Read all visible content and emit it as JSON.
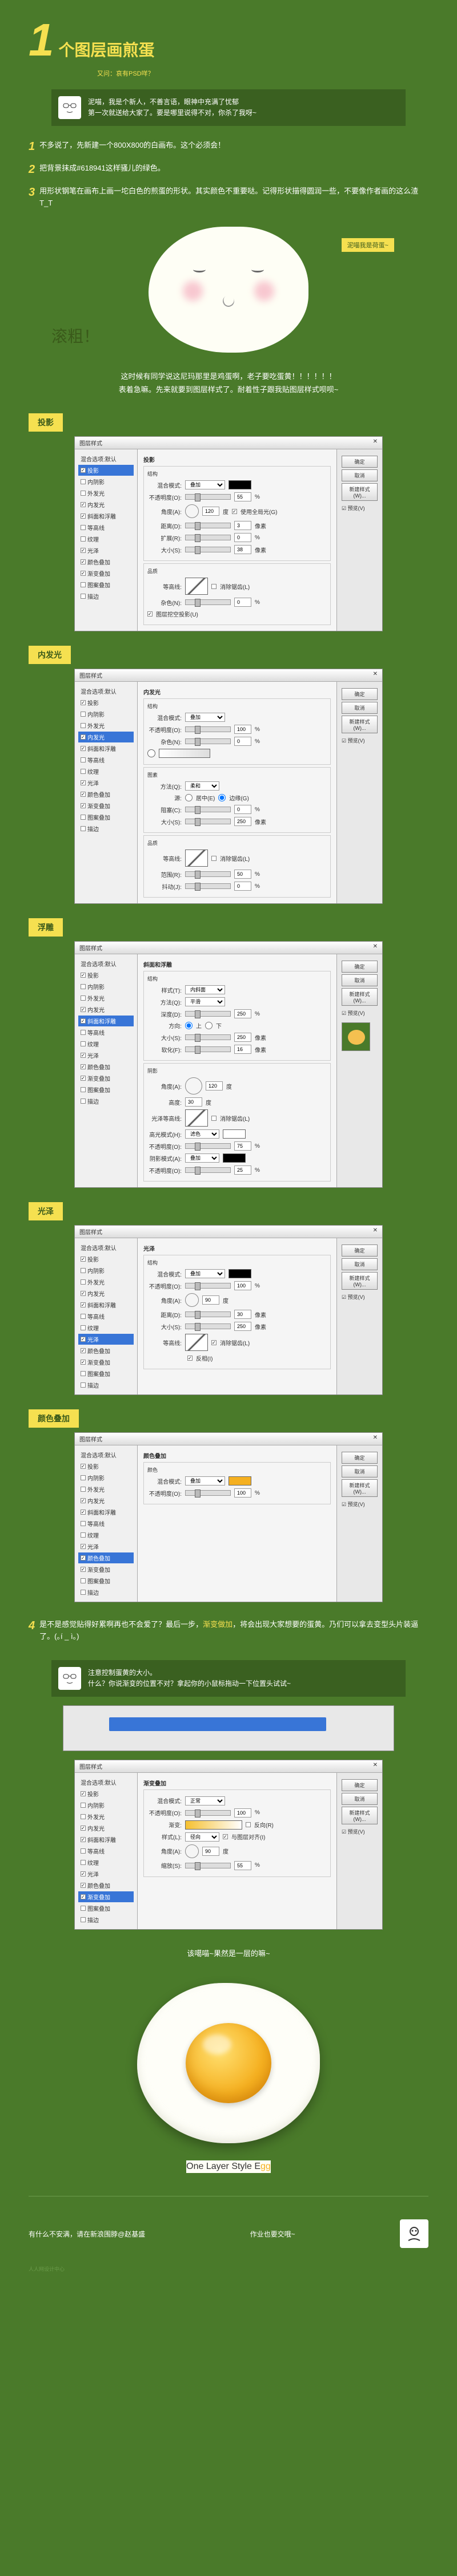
{
  "header": {
    "number": "1",
    "title": "个图层画煎蛋",
    "subtitle": "又问：哀有PSD咩？"
  },
  "intro": {
    "line1": "泥喵，我是个新人，不善言语，眼神中充满了忧郁",
    "line2": "第一次就送给大家了。要是哪里说得不对，你杀了我呀~"
  },
  "steps": [
    {
      "num": "1",
      "text": "不多说了，先新建一个800X800的白画布。这个必须会！"
    },
    {
      "num": "2",
      "text": "把背景抹成#618941这样骚儿的绿色。"
    },
    {
      "num": "3",
      "text": "用形状钢笔在画布上画一坨白色的煎蛋的形状。其实颜色不重要哒。记得形状描得圆润一些，不要像作者画的这么渣　　　　　T_T"
    }
  ],
  "blob": {
    "tag": "泥喵我是荷蛋~",
    "scroll": "滚粗！"
  },
  "mid_text": {
    "line1": "这时候有同学说这尼玛那里是鸡蛋啊，老子要吃蛋黄！！！！！！",
    "line2": "表着急嘛。先来就要到图层样式了。耐着性子跟我贴图层样式呗呗~"
  },
  "panels": {
    "p1": {
      "label": "投影"
    },
    "p2": {
      "label": "内发光"
    },
    "p3": {
      "label": "浮雕"
    },
    "p4": {
      "label": "光泽"
    },
    "p5": {
      "label": "颜色叠加"
    }
  },
  "ps": {
    "title": "图层样式",
    "left_items": [
      "混合选项:默认",
      "投影",
      "内阴影",
      "外发光",
      "内发光",
      "斜面和浮雕",
      "等高线",
      "纹理",
      "光泽",
      "颜色叠加",
      "渐变叠加",
      "图案叠加",
      "描边"
    ],
    "btns": {
      "ok": "确定",
      "cancel": "取消",
      "new": "新建样式(W)...",
      "preview": "☑ 预览(V)"
    },
    "shadow": {
      "section": "投影",
      "structure": "结构",
      "blend": "混合模式:",
      "blend_val": "叠加",
      "opacity": "不透明度(O):",
      "opacity_val": "55",
      "angle": "角度(A):",
      "angle_val": "120",
      "angle_unit": "度",
      "global": "使用全局光(G)",
      "distance": "距离(D):",
      "distance_val": "3",
      "px": "像素",
      "spread": "扩展(R):",
      "spread_val": "0",
      "pct": "%",
      "size": "大小(S):",
      "size_val": "38",
      "quality": "品质",
      "contour": "等高线:",
      "anti": "消除锯齿(L)",
      "noise": "杂色(N):",
      "noise_val": "0",
      "knockout": "图层挖空投影(U)"
    },
    "inner_glow": {
      "section": "内发光",
      "blend_val": "叠加",
      "opacity_val": "100",
      "noise_val": "0",
      "elements": "图素",
      "method": "方法(Q):",
      "method_val": "柔和",
      "source": "源:",
      "center": "居中(E)",
      "edge": "边缘(G)",
      "choke": "阻塞(C):",
      "choke_val": "0",
      "size_val": "250",
      "range": "范围(R):",
      "range_val": "50",
      "jitter": "抖动(J):",
      "jitter_val": "0"
    },
    "bevel": {
      "section": "斜面和浮雕",
      "style": "样式(T):",
      "style_val": "内斜面",
      "method_val": "平滑",
      "depth": "深度(D):",
      "depth_val": "250",
      "direction": "方向:",
      "up": "上",
      "down": "下",
      "size_val": "250",
      "soften": "软化(F):",
      "soften_val": "16",
      "shading": "阴影",
      "angle_val": "120",
      "altitude": "高度:",
      "altitude_val": "30",
      "gloss": "光泽等高线:",
      "highlight": "高光模式(H):",
      "highlight_val": "滤色",
      "hl_opacity": "75",
      "shadow_mode": "阴影模式(A):",
      "shadow_val": "叠加",
      "sh_opacity": "25"
    },
    "satin": {
      "section": "光泽",
      "blend_val": "叠加",
      "opacity_val": "100",
      "angle_val": "90",
      "distance_val": "30",
      "size_val": "250",
      "invert": "反相(I)"
    },
    "color_overlay": {
      "section": "颜色叠加",
      "color": "颜色",
      "blend_val": "叠加",
      "opacity_val": "100",
      "swatch": "#f5b020"
    }
  },
  "step4": {
    "num": "4",
    "text": "是不是感觉贴得好累啊再也不会爱了？最后一步，",
    "yellow": "渐变做加",
    "text2": "，将会出现大家想要的蛋黄。乃们可以拿去变型头片装逼了。(｡í _ ì｡)"
  },
  "warp": {
    "icon_text": "注意控制蛋黄的大小。",
    "line2": "什么？你说渐变的位置不对？拿起你的小鼠标拖动一下位置头试试~"
  },
  "conclusion": "该噶喵~果然是一层的嘛~",
  "egg": {
    "title_pre": "One Layer Style E",
    "title_g": "g",
    "title_g2": "g"
  },
  "footer": {
    "left": "有什么不安满，请在新浪围脖@赵基盛",
    "right": "作业也要交哦~"
  },
  "watermark": "人人网设计中心"
}
